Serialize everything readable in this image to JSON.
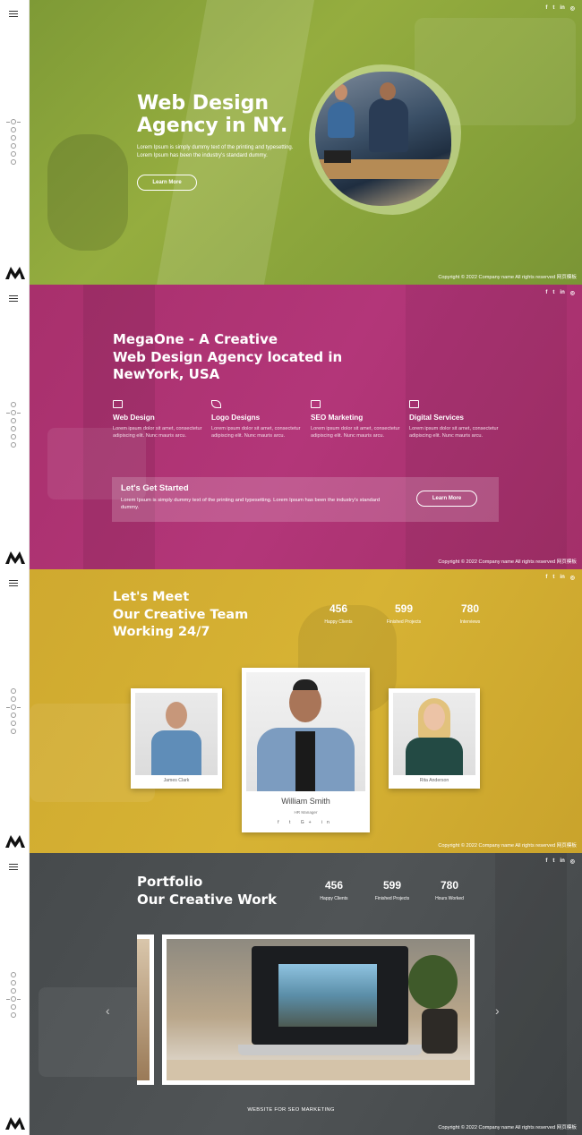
{
  "social": [
    "f",
    "t",
    "in",
    "◎"
  ],
  "copyright": "Copyright © 2022 Company name All rights reserved 网页模板",
  "hero": {
    "title_line1": "Web Design",
    "title_line2": "Agency in NY.",
    "text": "Lorem Ipsum is simply dummy text of the printing and typesetting. Lorem Ipsum has been the industry's standard dummy.",
    "button": "Learn More"
  },
  "about": {
    "title_line1": "MegaOne - A Creative",
    "title_line2": "Web Design Agency located in",
    "title_line3": "NewYork, USA",
    "services": [
      {
        "icon": "laptop-icon",
        "title": "Web Design",
        "text": "Lorem ipsum dolor sit amet, consectetur adipiscing elit. Nunc mauris arcu."
      },
      {
        "icon": "pen-icon",
        "title": "Logo Designs",
        "text": "Lorem ipsum dolor sit amet, consectetur adipiscing elit. Nunc mauris arcu."
      },
      {
        "icon": "megaphone-icon",
        "title": "SEO Marketing",
        "text": "Lorem ipsum dolor sit amet, consectetur adipiscing elit. Nunc mauris arcu."
      },
      {
        "icon": "chat-icon",
        "title": "Digital Services",
        "text": "Lorem ipsum dolor sit amet, consectetur adipiscing elit. Nunc mauris arcu."
      }
    ],
    "cta_title": "Let's Get Started",
    "cta_text": "Lorem Ipsum is simply dummy text of the printing and typesetting. Lorem Ipsum has been the industry's standard dummy.",
    "cta_button": "Learn More"
  },
  "team": {
    "title_line1": "Let's Meet",
    "title_line2": "Our Creative Team",
    "title_line3": "Working 24/7",
    "stats": [
      {
        "value": "456",
        "label": "Happy Clients"
      },
      {
        "value": "599",
        "label": "Finished Projects"
      },
      {
        "value": "780",
        "label": "Interviews"
      }
    ],
    "members": [
      {
        "name": "James Clark"
      },
      {
        "name": "William Smith",
        "role": "HR Manager",
        "social": "f  t  G+  in"
      },
      {
        "name": "Rita Anderson"
      }
    ]
  },
  "portfolio": {
    "title_line1": "Portfolio",
    "title_line2": "Our Creative Work",
    "stats": [
      {
        "value": "456",
        "label": "Happy Clients"
      },
      {
        "value": "599",
        "label": "Finished Projects"
      },
      {
        "value": "780",
        "label": "Hours Worked"
      }
    ],
    "caption": "WEBSITE FOR SEO MARKETING"
  },
  "colors": {
    "hero": "#8aa63a",
    "about": "#b03475",
    "team": "#d2ad32",
    "portfolio": "#4b4f51"
  }
}
